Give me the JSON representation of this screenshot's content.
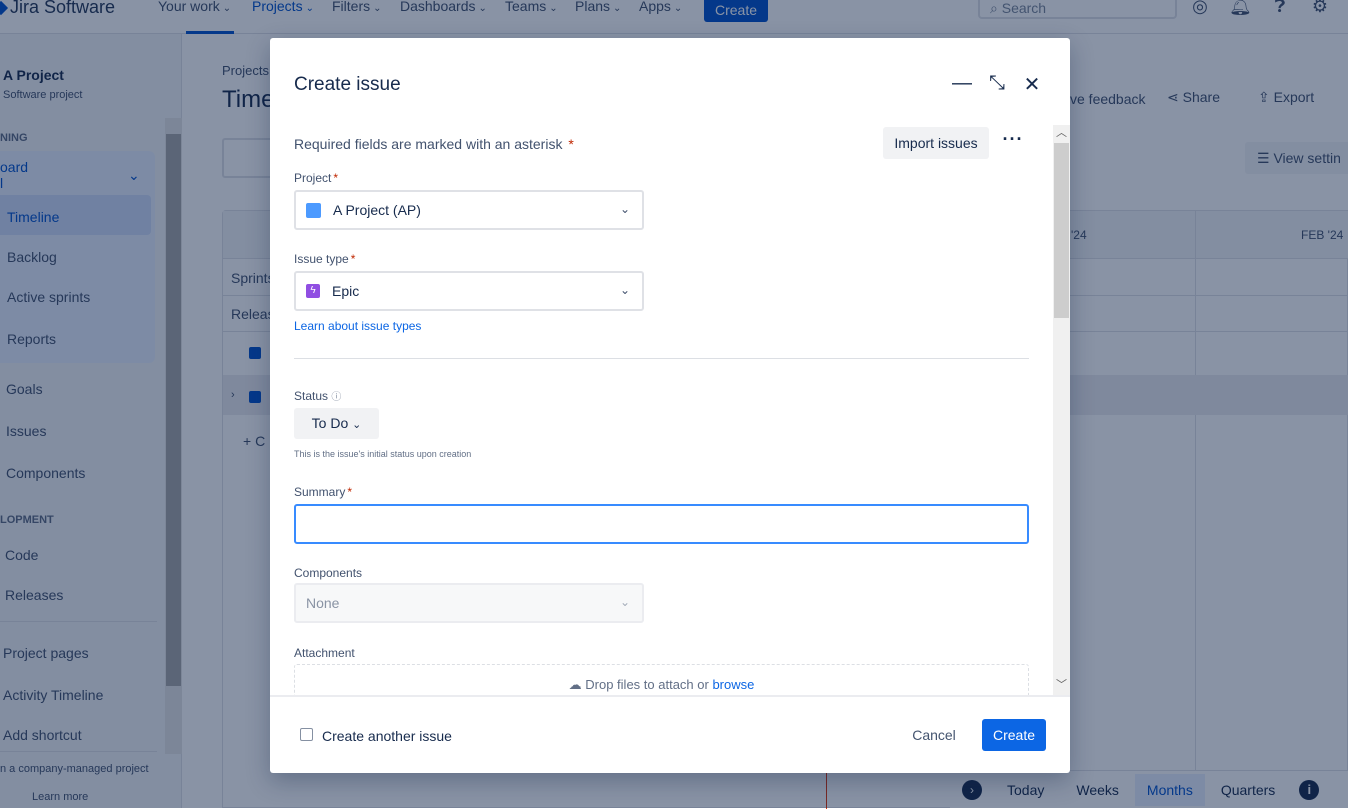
{
  "topnav": {
    "logo": "Jira Software",
    "items": [
      {
        "label": "Your work"
      },
      {
        "label": "Projects",
        "active": true
      },
      {
        "label": "Filters"
      },
      {
        "label": "Dashboards"
      },
      {
        "label": "Teams"
      },
      {
        "label": "Plans"
      },
      {
        "label": "Apps"
      }
    ],
    "create_label": "Create",
    "search_placeholder": "Search",
    "icons": [
      "compass-icon",
      "bell-icon",
      "help-icon",
      "settings-icon"
    ]
  },
  "sidebar": {
    "project_name": "A Project",
    "project_type": "Software project",
    "planning_header": "NING",
    "board_label": "oard",
    "board_sub": "l",
    "items_board": [
      "Timeline",
      "Backlog",
      "Active sprints",
      "Reports"
    ],
    "items_planning": [
      "Goals",
      "Issues",
      "Components"
    ],
    "dev_header": "LOPMENT",
    "items_dev": [
      "Code",
      "Releases"
    ],
    "items_other": [
      "Project pages",
      "Activity Timeline",
      "Add shortcut"
    ],
    "footer_text": "n a company-managed project",
    "learn_more": "Learn more"
  },
  "main": {
    "breadcrumb": "Projects",
    "title": "Time",
    "feedback": "ve feedback",
    "share": "Share",
    "export": "Export",
    "view_settings": "View settin",
    "month1": "'24",
    "month2": "FEB '24",
    "rows": [
      "Sprints",
      "Releas"
    ],
    "create_row": "C",
    "bottom_bar": {
      "today": "Today",
      "weeks": "Weeks",
      "months": "Months",
      "quarters": "Quarters",
      "active": "Months"
    }
  },
  "modal": {
    "title": "Create issue",
    "required_note": "Required fields are marked with an asterisk",
    "asterisk": "*",
    "import_label": "Import issues",
    "project": {
      "label": "Project",
      "value": "A Project (AP)"
    },
    "issue_type": {
      "label": "Issue type",
      "value": "Epic",
      "learn_link": "Learn about issue types"
    },
    "status": {
      "label": "Status",
      "value": "To Do",
      "help": "This is the issue's initial status upon creation"
    },
    "summary": {
      "label": "Summary",
      "value": ""
    },
    "components": {
      "label": "Components",
      "value": "None"
    },
    "attachment": {
      "label": "Attachment",
      "drop_text": "Drop files to attach or ",
      "browse": "browse"
    },
    "footer": {
      "create_another": "Create another issue",
      "create_another_checked": false,
      "cancel": "Cancel",
      "create": "Create"
    }
  },
  "colors": {
    "accent": "#0c66e4",
    "epic": "#904ee2",
    "required": "#bf2600"
  }
}
